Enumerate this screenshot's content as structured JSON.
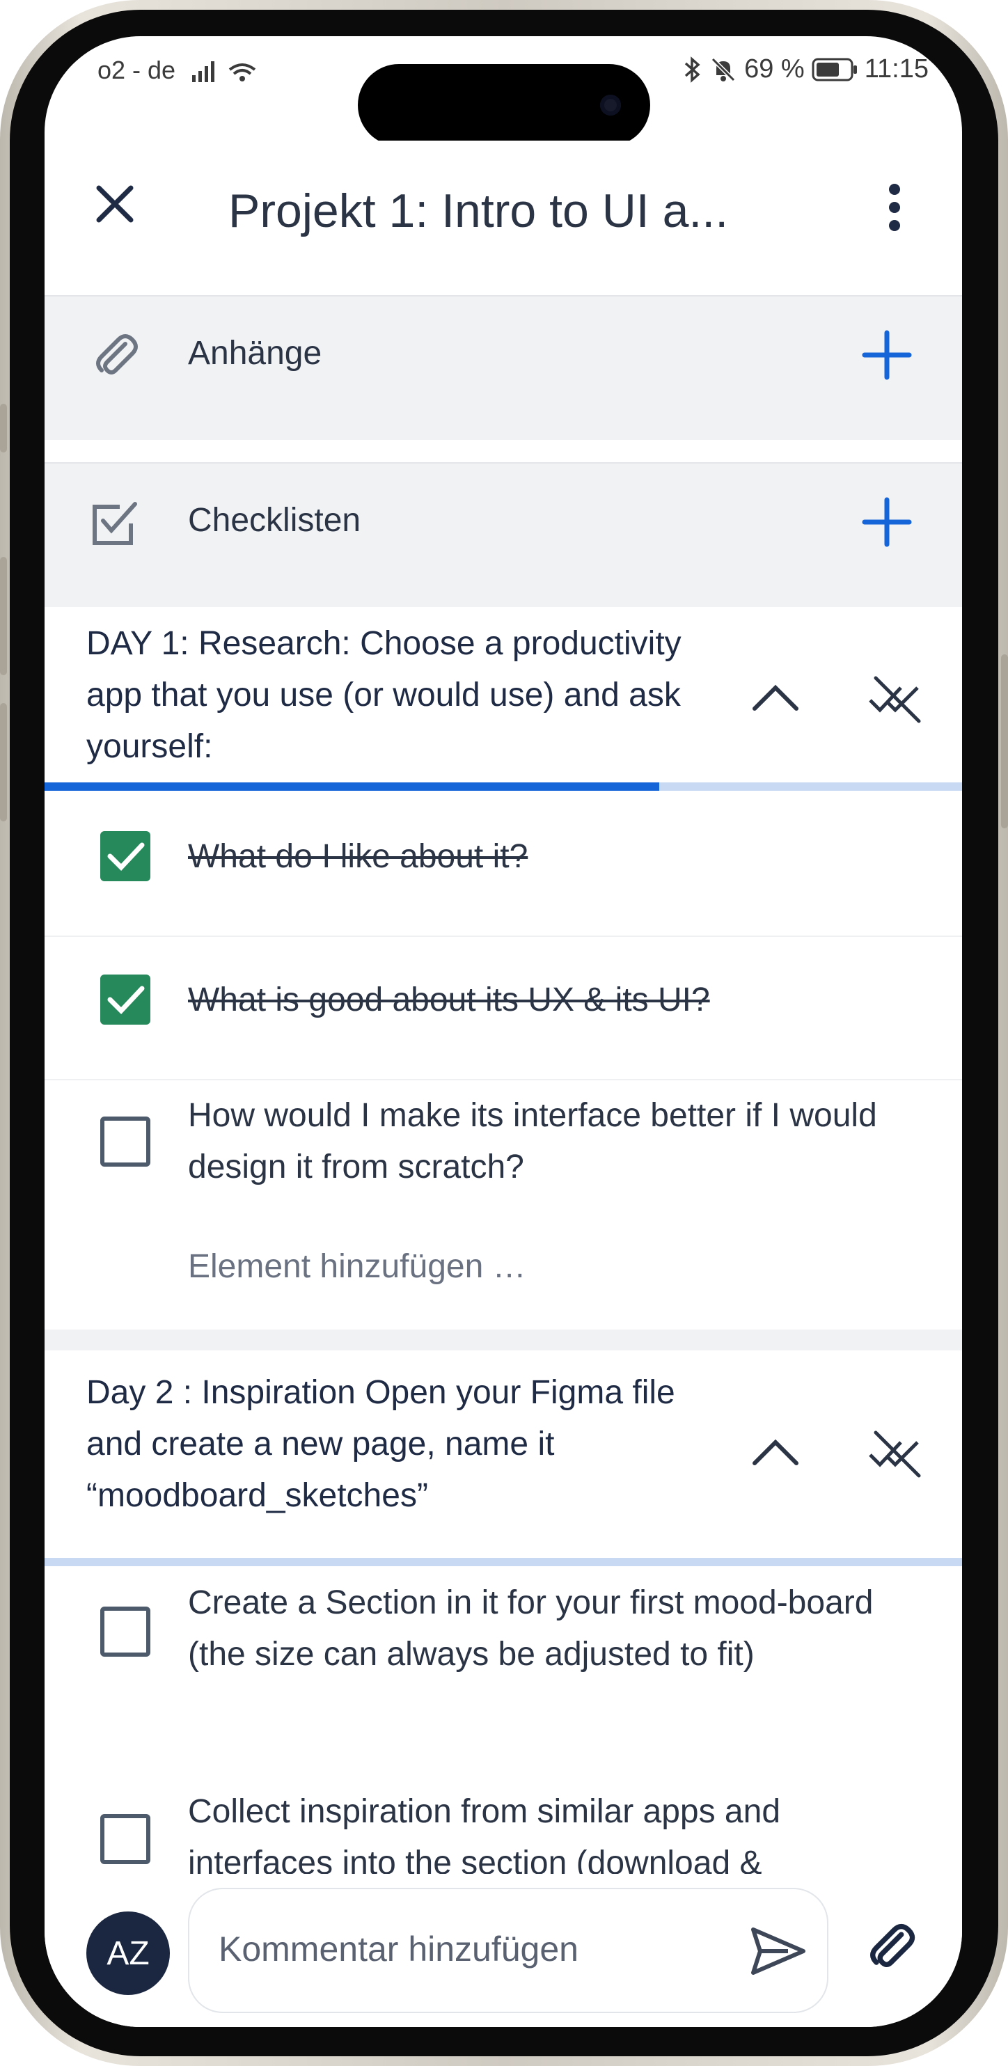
{
  "status_bar": {
    "carrier": "o2 - de",
    "battery": "69 %",
    "time": "11:15"
  },
  "header": {
    "title": "Projekt 1: Intro to UI a..."
  },
  "sections": {
    "attachments_label": "Anhänge",
    "checklists_label": "Checklisten"
  },
  "checklists": [
    {
      "title": "DAY 1: Research: Choose a productivity app that you use (or would use) and ask yourself:",
      "progress": 0.67,
      "items": [
        {
          "text": "What do I like about it?",
          "checked": true
        },
        {
          "text": "What is good about its UX & its UI?",
          "checked": true
        },
        {
          "text": "How would I make its interface better if I would design it from scratch?",
          "checked": false
        }
      ],
      "add_item_label": "Element hinzufügen …"
    },
    {
      "title": "Day 2 : Inspiration  Open your Figma file and create a new page, name it “moodboard_sketches”",
      "progress": 0,
      "items": [
        {
          "text": "Create a Section in it for your first mood-board (the size can always be adjusted to fit)",
          "checked": false
        },
        {
          "text": "Collect inspiration from similar apps and interfaces into the section (download &",
          "checked": false
        }
      ]
    }
  ],
  "footer": {
    "avatar_initials": "AZ",
    "comment_placeholder": "Kommentar hinzufügen"
  },
  "colors": {
    "accent": "#1565d8",
    "checked": "#25895b",
    "text": "#2b3445",
    "section_bg": "#f1f2f4"
  }
}
